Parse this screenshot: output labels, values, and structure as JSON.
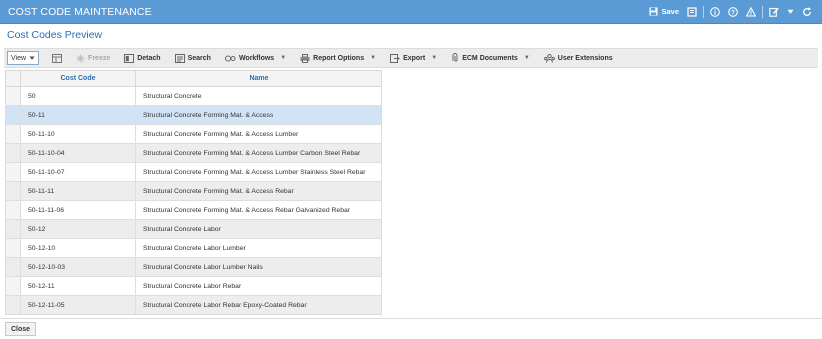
{
  "window": {
    "title": "COST CODE MAINTENANCE",
    "actions": {
      "save_label": "Save",
      "icons": [
        "save-icon",
        "notes-icon",
        "info-icon",
        "help-icon",
        "warning-icon",
        "edit-icon",
        "dropdown-icon",
        "refresh-icon"
      ]
    }
  },
  "subtitle": "Cost Codes Preview",
  "toolbar": {
    "view_label": "View",
    "freeze": "Freeze",
    "detach": "Detach",
    "search": "Search",
    "workflows": "Workflows",
    "report_options": "Report Options",
    "export": "Export",
    "ecm_documents": "ECM Documents",
    "user_extensions": "User Extensions"
  },
  "grid": {
    "columns": [
      "Cost Code",
      "Name"
    ],
    "rows": [
      {
        "code": "50",
        "name": "Structural Concrete"
      },
      {
        "code": "50-11",
        "name": "Structural Concrete Forming Mat. & Access"
      },
      {
        "code": "50-11-10",
        "name": "Structural Concrete Forming Mat. & Access Lumber"
      },
      {
        "code": "50-11-10-04",
        "name": "Structural Concrete Forming Mat. & Access Lumber Carbon Steel Rebar"
      },
      {
        "code": "50-11-10-07",
        "name": "Structural Concrete Forming Mat. & Access Lumber Stainless Steel Rebar"
      },
      {
        "code": "50-11-11",
        "name": "Structural Concrete Forming Mat. & Access Rebar"
      },
      {
        "code": "50-11-11-06",
        "name": "Structural Concrete Forming Mat. & Access Rebar Galvanized Rebar"
      },
      {
        "code": "50-12",
        "name": "Structural Concrete Labor"
      },
      {
        "code": "50-12-10",
        "name": "Structural Concrete Labor Lumber"
      },
      {
        "code": "50-12-10-03",
        "name": "Structural Concrete Labor Lumber Nails"
      },
      {
        "code": "50-12-11",
        "name": "Structural Concrete Labor Rebar"
      },
      {
        "code": "50-12-11-05",
        "name": "Structural Concrete Labor Rebar Epoxy-Coated Rebar"
      }
    ],
    "selected_row": 1
  },
  "footer": {
    "close_label": "Close"
  },
  "colors": {
    "titlebar": "#5b9bd5",
    "accent": "#2a6fb3",
    "selected_row": "#d2e3f6",
    "alt_row": "#ededed"
  }
}
